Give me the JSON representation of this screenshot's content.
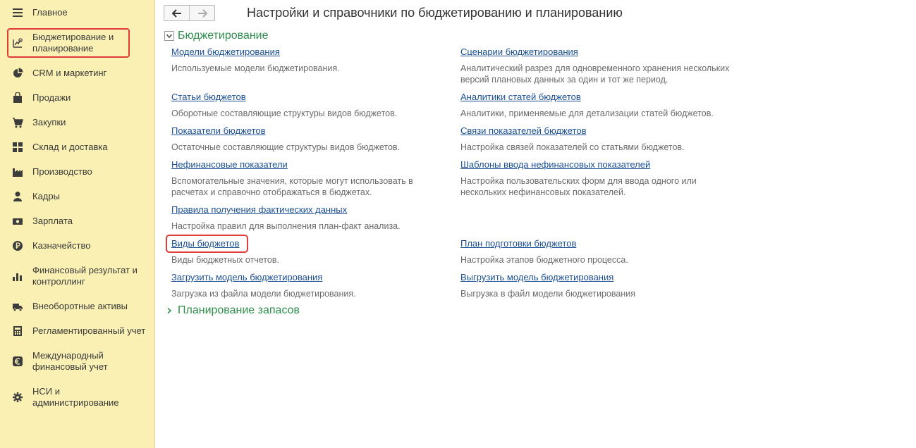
{
  "sidebar": {
    "items": [
      {
        "label": "Главное",
        "icon": "menu-lines-icon"
      },
      {
        "label": "Бюджетирование и\nпланирование",
        "icon": "budget-planning-icon"
      },
      {
        "label": "CRM и маркетинг",
        "icon": "pie-chart-icon"
      },
      {
        "label": "Продажи",
        "icon": "shopping-bag-icon"
      },
      {
        "label": "Закупки",
        "icon": "cart-icon"
      },
      {
        "label": "Склад и доставка",
        "icon": "warehouse-grid-icon"
      },
      {
        "label": "Производство",
        "icon": "factory-icon"
      },
      {
        "label": "Кадры",
        "icon": "person-icon"
      },
      {
        "label": "Зарплата",
        "icon": "money-icon"
      },
      {
        "label": "Казначейство",
        "icon": "ruble-coin-icon"
      },
      {
        "label": "Финансовый результат и\nконтроллинг",
        "icon": "bar-chart-icon"
      },
      {
        "label": "Внеоборотные активы",
        "icon": "truck-icon"
      },
      {
        "label": "Регламентированный учет",
        "icon": "calculator-icon"
      },
      {
        "label": "Международный\nфинансовый учет",
        "icon": "euro-icon"
      },
      {
        "label": "НСИ и\nадминистрирование",
        "icon": "gear-icon"
      }
    ]
  },
  "header": {
    "title": "Настройки и справочники по бюджетированию и планированию",
    "back_icon": "arrow-left-icon",
    "forward_icon": "arrow-right-icon"
  },
  "groups": {
    "budgeting": {
      "title": "Бюджетирование",
      "expanded": true
    },
    "inventory": {
      "title": "Планирование запасов",
      "expanded": false
    }
  },
  "items": {
    "left": [
      {
        "link": "Модели бюджетирования",
        "desc": "Используемые модели бюджетирования."
      },
      {
        "link": "Статьи бюджетов",
        "desc": "Оборотные составляющие структуры видов бюджетов."
      },
      {
        "link": "Показатели бюджетов",
        "desc": "Остаточные составляющие структуры видов бюджетов."
      },
      {
        "link": "Нефинансовые показатели",
        "desc": "Вспомогательные значения, которые могут использовать в расчетах и справочно отображаться в бюджетах."
      },
      {
        "link": "Правила получения фактических данных",
        "desc": "Настройка правил для выполнения план-факт анализа."
      },
      {
        "link": "Виды бюджетов",
        "desc": "Виды бюджетных отчетов."
      },
      {
        "link": "Загрузить модель бюджетирования",
        "desc": "Загрузка из файла модели бюджетирования."
      }
    ],
    "right": [
      {
        "link": "Сценарии бюджетирования",
        "desc": "Аналитический разрез для одновременного хранения нескольких версий плановых данных за один и тот же период."
      },
      {
        "link": "Аналитики статей бюджетов",
        "desc": "Аналитики, применяемые для детализации статей бюджетов."
      },
      {
        "link": "Связи показателей бюджетов",
        "desc": "Настройка связей показателей со статьями бюджетов."
      },
      {
        "link": "Шаблоны ввода нефинансовых показателей",
        "desc": "Настройка пользовательских форм для ввода одного или нескольких нефинансовых показателей."
      },
      {
        "link": "План подготовки бюджетов",
        "desc": "Настройка этапов бюджетного процесса."
      },
      {
        "link": "Выгрузить модель бюджетирования",
        "desc": "Выгрузка в файл модели бюджетирования"
      }
    ]
  }
}
